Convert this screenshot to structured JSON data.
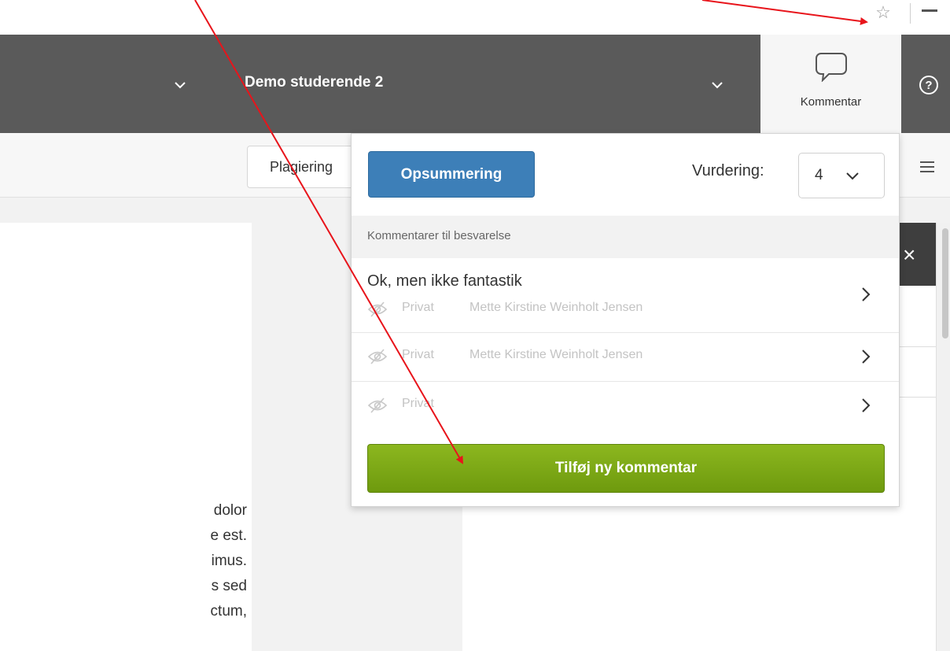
{
  "browser": {
    "star_icon": "star-outline-icon"
  },
  "header": {
    "student_name": "Demo studerende 2",
    "comment_tab_label": "Kommentar",
    "help_icon": "question-circle-icon"
  },
  "toolbar": {
    "plagiarism_label": "Plagiering"
  },
  "document": {
    "lines": [
      "dolor",
      "e  est.",
      "imus.",
      "s  sed",
      "ctum,"
    ]
  },
  "popup": {
    "summary_button": "Opsummering",
    "grade_label": "Vurdering:",
    "grade_value": "4",
    "section_header": "Kommentarer til besvarelse",
    "comments": [
      {
        "title": "Ok, men ikke fantastik",
        "visibility": "Privat",
        "author": "Mette Kirstine Weinholt Jensen"
      },
      {
        "title": "",
        "visibility": "Privat",
        "author": "Mette Kirstine Weinholt Jensen"
      },
      {
        "title": "",
        "visibility": "Privat",
        "author": ""
      }
    ],
    "add_button": "Tilføj ny kommentar"
  },
  "colors": {
    "header_bg": "#5a5a5a",
    "summary_blue": "#3d7fb8",
    "add_green": "#7aa815",
    "annotation_red": "#e8141b"
  }
}
